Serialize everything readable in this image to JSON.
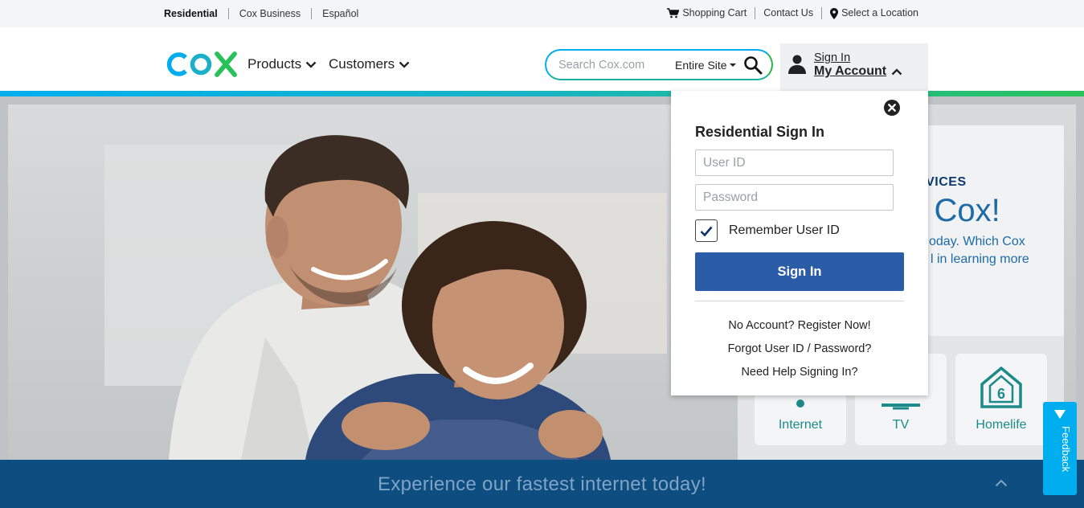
{
  "utility": {
    "left_links": [
      "Residential",
      "Cox Business",
      "Español"
    ],
    "shopping_cart": "Shopping Cart",
    "contact_us": "Contact Us",
    "select_location": "Select a Location"
  },
  "header": {
    "logo_text": "COX",
    "nav": [
      {
        "label": "Products",
        "icon": "chevron-down-icon"
      },
      {
        "label": "Customers",
        "icon": "chevron-down-icon"
      }
    ],
    "search": {
      "placeholder": "Search Cox.com",
      "scope": "Entire Site"
    },
    "account": {
      "sign_in": "Sign In",
      "my_account": "My Account"
    }
  },
  "signin_dropdown": {
    "title": "Residential Sign In",
    "user_id_placeholder": "User ID",
    "password_placeholder": "Password",
    "remember_label": "Remember User ID",
    "remember_checked": true,
    "button": "Sign In",
    "links": {
      "register": "No Account? Register Now!",
      "forgot_user_id": "Forgot User ID",
      "forgot_sep": "/",
      "forgot_password": "Password?",
      "help": "Need Help Signing In?"
    }
  },
  "hero": {
    "eyebrow": "SERVICES",
    "headline": "to Cox!",
    "desc_line1": "oday.  Which Cox",
    "desc_line2": "l in learning more",
    "tiles": [
      {
        "label": "Internet",
        "icon": "internet-icon"
      },
      {
        "label": "TV",
        "icon": "tv-icon"
      },
      {
        "label": "Homelife",
        "icon": "home-icon"
      }
    ]
  },
  "banner": {
    "text": "Experience our fastest internet today!"
  },
  "feedback": {
    "label": "Feedback"
  },
  "colors": {
    "brand_blue": "#00aeef",
    "brand_green": "#29c25a",
    "signin_button": "#2a5ca8",
    "banner": "#0d4d80"
  }
}
